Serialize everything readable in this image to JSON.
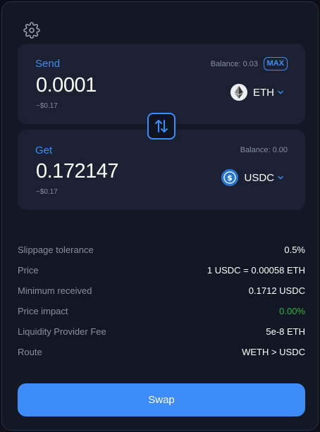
{
  "colors": {
    "accent": "#3d8cf7",
    "card_bg": "#1b2132",
    "panel_bg": "#121724",
    "positive": "#2fb344",
    "muted_text": "#8a90a0"
  },
  "header": {
    "settings_icon": "gear-icon"
  },
  "send": {
    "label": "Send",
    "balance": "Balance: 0.03",
    "max_label": "MAX",
    "amount": "0.0001",
    "usd_value": "~$0.17",
    "token": {
      "symbol": "ETH",
      "icon": "eth-icon"
    }
  },
  "toggle": {
    "icon": "swap-vertical-icon"
  },
  "get": {
    "label": "Get",
    "balance": "Balance: 0.00",
    "amount": "0.172147",
    "usd_value": "~$0.17",
    "token": {
      "symbol": "USDC",
      "icon": "usdc-icon"
    }
  },
  "details": [
    {
      "label": "Slippage tolerance",
      "value": "0.5%"
    },
    {
      "label": "Price",
      "value": "1 USDC = 0.00058 ETH"
    },
    {
      "label": "Minimum received",
      "value": "0.1712 USDC"
    },
    {
      "label": "Price impact",
      "value": "0.00%"
    },
    {
      "label": "Liquidity Provider Fee",
      "value": "5e-8 ETH"
    },
    {
      "label": "Route",
      "value": "WETH > USDC"
    }
  ],
  "action": {
    "swap_label": "Swap"
  }
}
